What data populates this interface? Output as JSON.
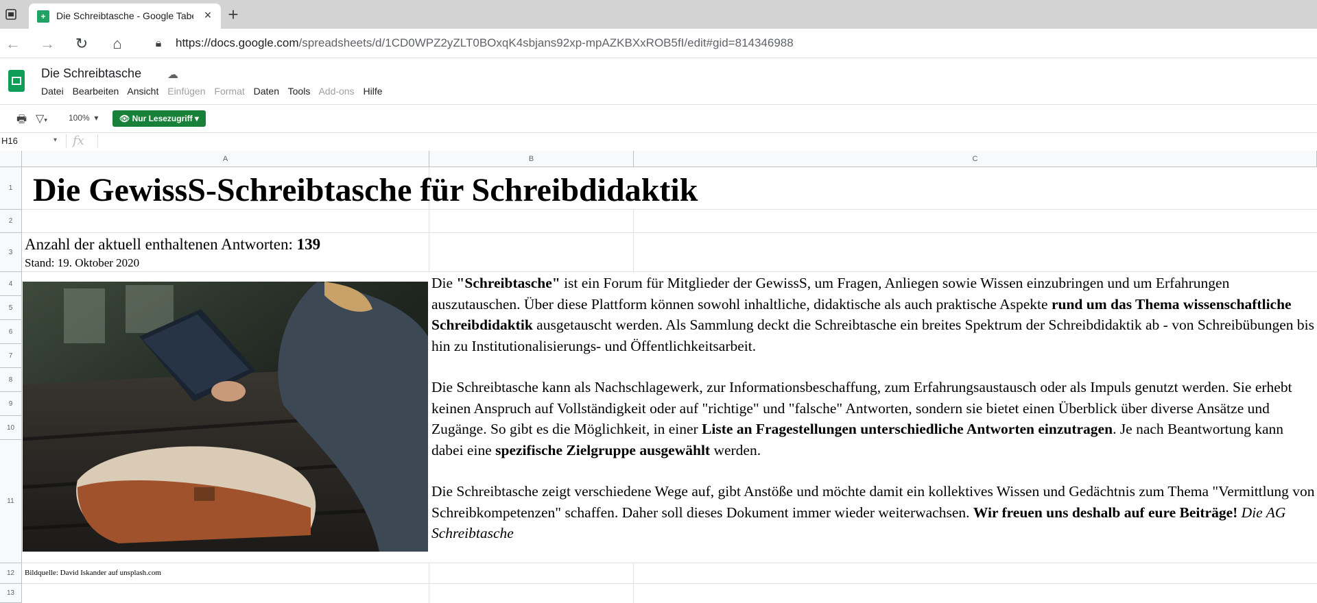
{
  "browser": {
    "tab_title": "Die Schreibtasche - Google Tabe",
    "url_host": "https://docs.google.com",
    "url_path": "/spreadsheets/d/1CD0WPZ2yZLT0BOxqK4sbjans92xp-mpAZKBXxROB5fI/edit#gid=814346988"
  },
  "app": {
    "doc_title": "Die Schreibtasche",
    "menu": [
      "Datei",
      "Bearbeiten",
      "Ansicht",
      "Einfügen",
      "Format",
      "Daten",
      "Tools",
      "Add-ons",
      "Hilfe"
    ],
    "menu_disabled": [
      "Einfügen",
      "Format",
      "Add-ons"
    ],
    "zoom": "100%",
    "readonly_label": "Nur Lesezugriff",
    "name_box": "H16",
    "fx_label": "fx"
  },
  "grid": {
    "columns": [
      "A",
      "B",
      "C"
    ],
    "rows": [
      "1",
      "2",
      "3",
      "4",
      "5",
      "6",
      "7",
      "8",
      "9",
      "10",
      "11",
      "12",
      "13"
    ]
  },
  "content": {
    "title": "Die GewissS-Schreibtasche für Schreibdidaktik",
    "count_label": "Anzahl der aktuell enthaltenen Antworten: ",
    "count_value": "139",
    "date": "Stand: 19. Oktober 2020",
    "credit": "Bildquelle: David Iskander auf unsplash.com",
    "p1_a": "Die ",
    "p1_b": "\"Schreibtasche\"",
    "p1_c": " ist ein Forum für Mitglieder der GewissS, um Fragen, Anliegen sowie Wissen einzubringen und um Erfahrungen auszutauschen. Über diese Plattform können sowohl inhaltliche, didaktische als auch praktische Aspekte ",
    "p1_d": "rund um das Thema wissenschaftliche Schreibdidaktik",
    "p1_e": " ausgetauscht werden. Als Sammlung deckt die Schreibtasche ein breites Spektrum der Schreibdidaktik ab - von Schreibübungen bis hin zu Institutionalisierungs- und Öffentlichkeitsarbeit.",
    "p2_a": "Die Schreibtasche kann als Nachschlagewerk, zur Informationsbeschaffung, zum Erfahrungsaustausch oder als Impuls genutzt werden. Sie erhebt keinen Anspruch auf Vollständigkeit oder auf \"richtige\" und \"falsche\" Antworten, sondern sie bietet einen Überblick über diverse Ansätze und Zugänge. So gibt es die Möglichkeit, in einer ",
    "p2_b": "Liste an Fragestellungen unterschiedliche Antworten einzutragen",
    "p2_c": ". Je nach Beantwortung kann dabei eine ",
    "p2_d": "spezifische Zielgruppe ausgewählt",
    "p2_e": " werden.",
    "p3_a": "Die Schreibtasche zeigt verschiedene Wege auf, gibt Anstöße und möchte damit ein kollektives Wissen und Gedächtnis zum Thema \"Vermittlung von Schreibkompetenzen\" schaffen. Daher soll dieses Dokument immer wieder weiterwachsen. ",
    "p3_b": "Wir freuen uns deshalb auf eure Beiträge!",
    "p3_c": " ",
    "p3_d": "Die AG Schreibtasche"
  }
}
